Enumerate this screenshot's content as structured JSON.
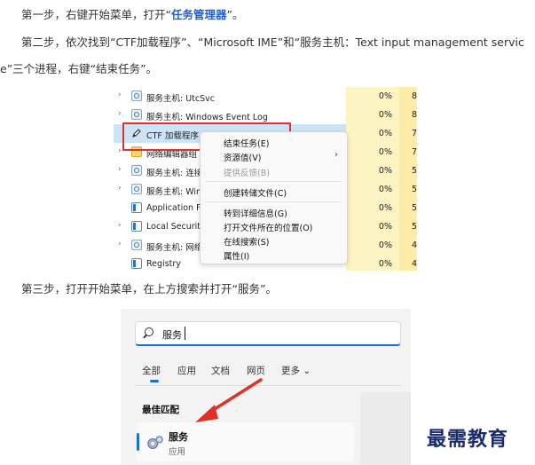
{
  "steps": {
    "step1_prefix": "第一步，右键开始菜单，打开“",
    "step1_highlight": "任务管理器",
    "step1_suffix": "”。",
    "step2_line1": "第二步，依次找到“CTF加载程序”、“Microsoft IME”和“服务主机：Text input management servic",
    "step2_line2": "e”三个进程，右键“结束任务”。",
    "step3": "第三步，打开开始菜单，在上方搜索并打开“服务”。"
  },
  "task_manager": {
    "rows": [
      {
        "chevron": "›",
        "icon": "gear-icon",
        "name": "服务主机: UtcSvc",
        "cpu": "0%",
        "mem": "8"
      },
      {
        "chevron": "›",
        "icon": "gear-icon",
        "name": "服务主机: Windows Event Log",
        "cpu": "0%",
        "mem": "8"
      },
      {
        "chevron": "",
        "icon": "pen-icon",
        "name": "CTF 加载程序",
        "cpu": "0%",
        "mem": "7",
        "selected": true
      },
      {
        "chevron": "›",
        "icon": "folder-icon",
        "name": "网络编辑器组",
        "cpu": "0%",
        "mem": "7"
      },
      {
        "chevron": "›",
        "icon": "gear-icon",
        "name": "服务主机: 连接",
        "cpu": "0%",
        "mem": "5"
      },
      {
        "chevron": "›",
        "icon": "gear-icon",
        "name": "服务主机: Wind",
        "cpu": "0%",
        "mem": "5"
      },
      {
        "chevron": "",
        "icon": "window-icon",
        "name": "Application Fr",
        "cpu": "0%",
        "mem": "5"
      },
      {
        "chevron": "›",
        "icon": "window-icon",
        "name": "Local Security",
        "cpu": "0%",
        "mem": "5"
      },
      {
        "chevron": "›",
        "icon": "gear-icon",
        "name": "服务主机: 网络",
        "cpu": "0%",
        "mem": "4"
      },
      {
        "chevron": "",
        "icon": "window-icon",
        "name": "Registry",
        "cpu": "0%",
        "mem": "4"
      }
    ]
  },
  "context_menu": {
    "end_task": "结束任务(E)",
    "resource_values": "资源值(V)",
    "resource_values_arrow": "›",
    "feedback": "提供反馈(B)",
    "dump_file": "创建转储文件(C)",
    "go_to_details": "转到详细信息(G)",
    "open_file_location": "打开文件所在的位置(O)",
    "search_online": "在线搜索(S)",
    "properties": "属性(I)"
  },
  "search": {
    "query": "服务",
    "tabs": [
      "全部",
      "应用",
      "文档",
      "网页",
      "更多 ⌄"
    ],
    "best_match_label": "最佳匹配",
    "result_title": "服务",
    "result_subtitle": "应用"
  },
  "watermark": "最需教育",
  "colors": {
    "highlight_blue": "#1e5fd8",
    "red_box": "#e0302a",
    "red_arrow": "#e0302a",
    "cpu_column": "#fdf4c4"
  }
}
